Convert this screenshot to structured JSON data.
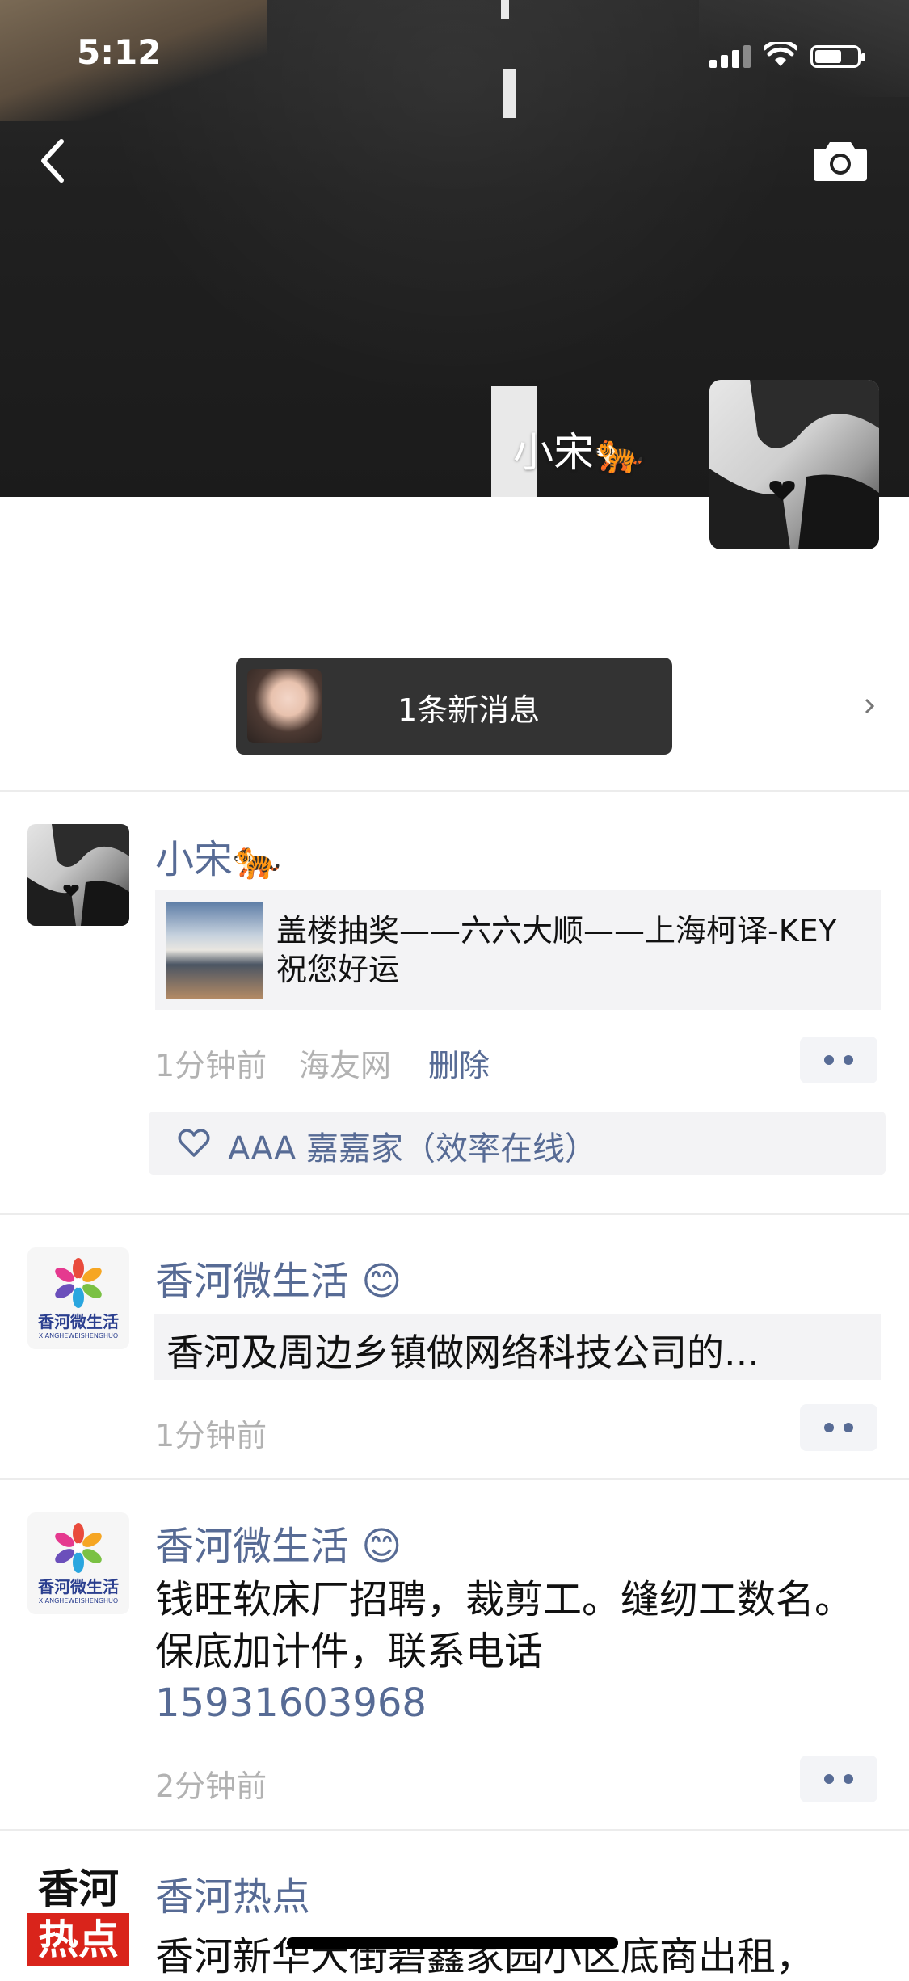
{
  "status_bar": {
    "time": "5:12"
  },
  "profile": {
    "name": "小宋🐅"
  },
  "new_message": {
    "label": "1条新消息"
  },
  "posts": [
    {
      "author": "小宋🐅",
      "link_title": "盖楼抽奖——六六大顺——上海柯译-KEY 祝您好运",
      "time": "1分钟前",
      "source": "海友网",
      "delete_label": "删除",
      "likes": "AAA 嘉嘉家（效率在线）"
    },
    {
      "author": "香河微生活 😊",
      "share_text": "香河及周边乡镇做网络科技公司的...",
      "time": "1分钟前"
    },
    {
      "author": "香河微生活 😊",
      "text": "钱旺软床厂招聘，裁剪工。缝纫工数名。保底加计件，联系电话",
      "phone": "15931603968",
      "time": "2分钟前"
    },
    {
      "author": "香河热点",
      "text": "香河新华大街碧鑫家园小区底商出租，"
    }
  ],
  "logos": {
    "xianghe_micro_life": {
      "name": "香河微生活",
      "sub": "XIANGHEWEISHENGHUO"
    },
    "xianghe_hotspot": {
      "top": "香河",
      "bottom": "热点"
    }
  },
  "colors": {
    "link": "#576b95",
    "meta": "#b2b2b2",
    "card_bg": "#f3f3f5",
    "pill_bg": "#333333"
  }
}
